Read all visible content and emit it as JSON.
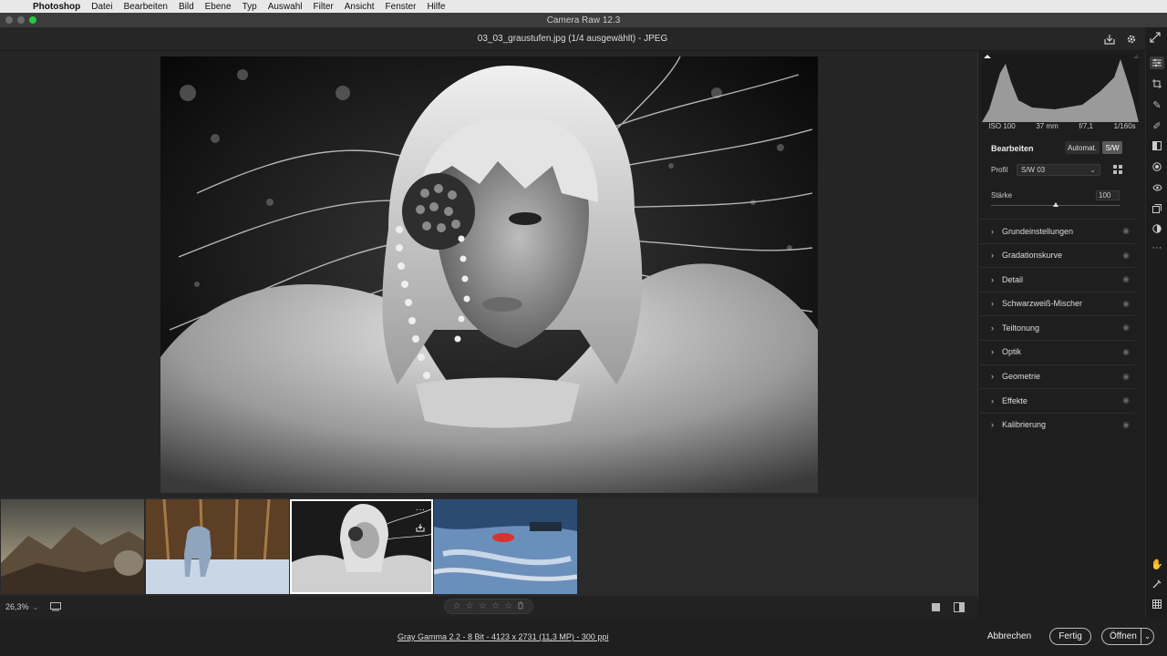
{
  "menubar": {
    "items": [
      "Photoshop",
      "Datei",
      "Bearbeiten",
      "Bild",
      "Ebene",
      "Typ",
      "Auswahl",
      "Filter",
      "Ansicht",
      "Fenster",
      "Hilfe"
    ]
  },
  "window": {
    "title": "Camera Raw 12.3"
  },
  "document": {
    "title": "03_03_graustufen.jpg (1/4 ausgewählt)  -  JPEG"
  },
  "histogram": {
    "iso": "ISO 100",
    "focal": "37 mm",
    "aperture": "f/7,1",
    "shutter": "1/160s"
  },
  "edit": {
    "title": "Bearbeiten",
    "auto_label": "Automat.",
    "bw_label": "S/W",
    "profile_label": "Profil",
    "profile_value": "S/W 03",
    "strength_label": "Stärke",
    "strength_value": "100",
    "strength_level": 0.5
  },
  "sections": [
    "Grundeinstellungen",
    "Gradationskurve",
    "Detail",
    "Schwarzweiß-Mischer",
    "Teiltonung",
    "Optik",
    "Geometrie",
    "Effekte",
    "Kalibrierung"
  ],
  "filmstrip": {
    "thumbs": [
      {
        "name": "mountains-thumbnail",
        "selected": false
      },
      {
        "name": "dog-snow-thumbnail",
        "selected": false
      },
      {
        "name": "portrait-bw-thumbnail",
        "selected": true
      },
      {
        "name": "kayak-thumbnail",
        "selected": false
      }
    ]
  },
  "bottombar": {
    "zoom": "26,3%",
    "stars": [
      "☆",
      "☆",
      "☆",
      "☆",
      "☆"
    ]
  },
  "footer": {
    "info": "Gray Gamma 2.2 - 8 Bit - 4123 x 2731 (11,3 MP) - 300 ppi",
    "cancel": "Abbrechen",
    "done": "Fertig",
    "open": "Öffnen"
  },
  "colors": {
    "accent_green": "#27c93f",
    "panel_bg": "#1e1e1e",
    "canvas_bg": "#252525"
  }
}
